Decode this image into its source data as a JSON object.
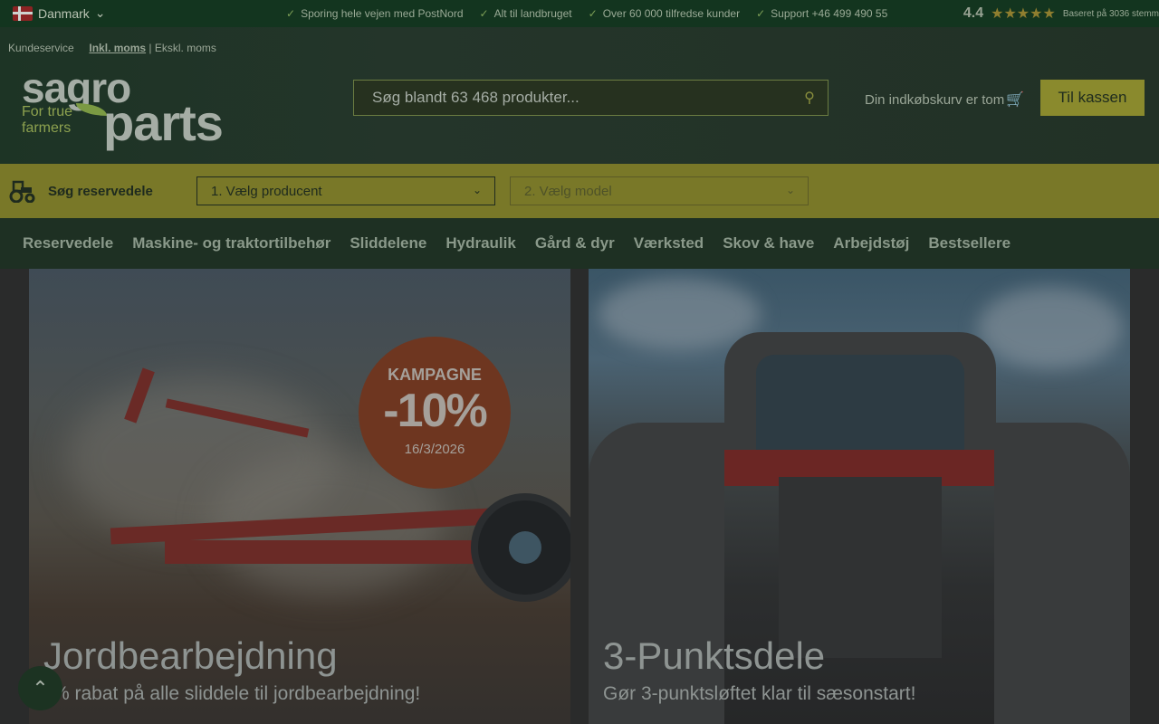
{
  "topbar": {
    "country": "Danmark",
    "usps": [
      "Sporing hele vejen med PostNord",
      "Alt til landbruget",
      "Over 60 000 tilfredse kunder",
      "Support +46 499 490 55"
    ],
    "rating_score": "4.4",
    "rating_text": "Baseret på 3036 stemm"
  },
  "header": {
    "customer_service": "Kundeservice",
    "incl_vat": "Inkl. moms",
    "separator": "|",
    "excl_vat": "Ekskl. moms",
    "logo_top": "sagro",
    "logo_bottom": "parts",
    "logo_tagline_1": "For true",
    "logo_tagline_2": "farmers",
    "search_placeholder": "Søg blandt 63 468 produkter...",
    "cart_text": "Din indkøbskurv er tom",
    "checkout_label": "Til kassen"
  },
  "partsbar": {
    "label": "Søg reservedele",
    "select_manufacturer": "1. Vælg producent",
    "select_model": "2. Vælg model"
  },
  "nav": [
    "Reservedele",
    "Maskine- og traktortilbehør",
    "Sliddelene",
    "Hydraulik",
    "Gård & dyr",
    "Værksted",
    "Skov & have",
    "Arbejdstøj",
    "Bestsellere"
  ],
  "cards": [
    {
      "title": "Jordbearbejdning",
      "subtitle": "% rabat på alle sliddele til jordbearbejdning!",
      "badge_top": "KAMPAGNE",
      "badge_value": "-10%",
      "badge_date": "16/3/2026"
    },
    {
      "title": "3-Punktsdele",
      "subtitle": "Gør 3-punktsløftet klar til sæsonstart!"
    }
  ],
  "colors": {
    "brand_dark": "#13351f",
    "accent_yellow": "#797828",
    "checkout": "#8a8a2d"
  }
}
